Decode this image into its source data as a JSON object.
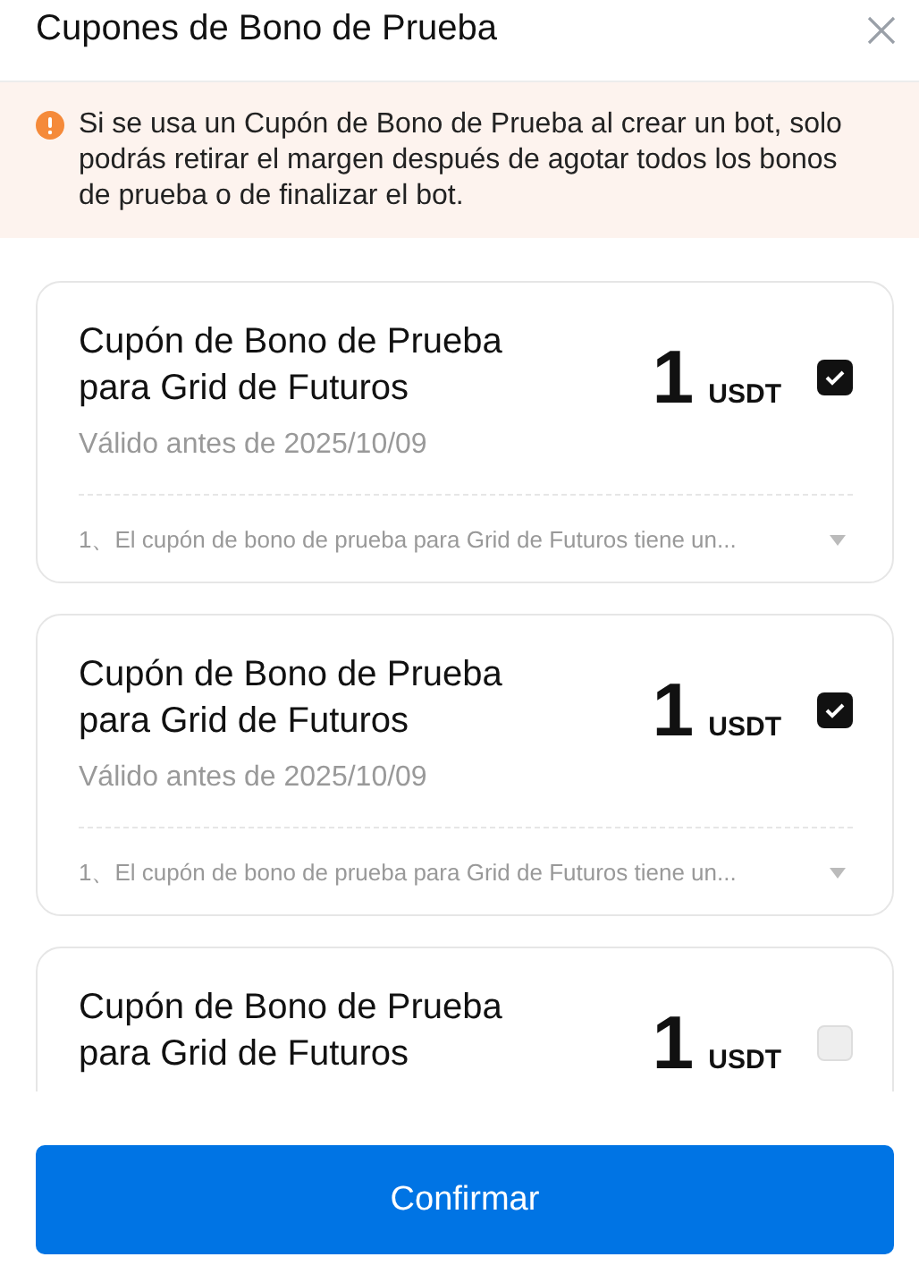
{
  "header": {
    "title": "Cupones de Bono de Prueba"
  },
  "notice": {
    "text": "Si se usa un Cupón de Bono de Prueba al crear un bot, solo podrás retirar el margen después de agotar todos los bonos de prueba o de finalizar el bot."
  },
  "coupons": [
    {
      "title": "Cupón de Bono de Prueba para Grid de Futuros",
      "valid": "Válido antes de 2025/10/09",
      "amount": "1",
      "unit": "USDT",
      "checked": true,
      "terms": "1、El cupón de bono de prueba para Grid de Futuros tiene un..."
    },
    {
      "title": "Cupón de Bono de Prueba para Grid de Futuros",
      "valid": "Válido antes de 2025/10/09",
      "amount": "1",
      "unit": "USDT",
      "checked": true,
      "terms": "1、El cupón de bono de prueba para Grid de Futuros tiene un..."
    },
    {
      "title": "Cupón de Bono de Prueba para Grid de Futuros",
      "amount": "1",
      "unit": "USDT",
      "checked": false
    }
  ],
  "confirm_button": "Confirmar"
}
